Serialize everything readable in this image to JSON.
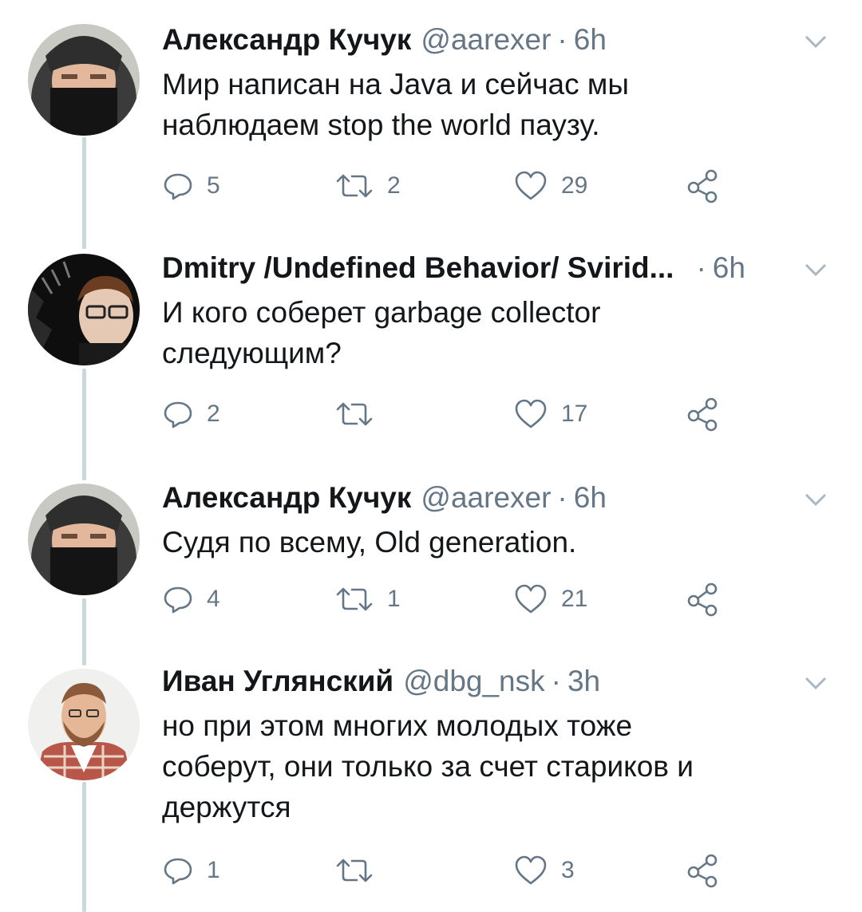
{
  "colors": {
    "text": "#14171a",
    "muted": "#657786",
    "line": "#ccd6dd"
  },
  "tweets": [
    {
      "name": "Александр Кучук",
      "handle": "@aarexer",
      "time": "6h",
      "text_lines": [
        "Мир написан на Java и сейчас мы",
        "наблюдаем stop the world паузу."
      ],
      "replies": "5",
      "retweets": "2",
      "likes": "29",
      "avatar_icon": "masked-person-avatar"
    },
    {
      "name": "Dmitry /Undefined Behavior/ Svirid...",
      "handle": "",
      "time": "6h",
      "text_lines": [
        "И кого соберет garbage collector",
        "следующим?"
      ],
      "replies": "2",
      "retweets": "",
      "likes": "17",
      "avatar_icon": "glasses-person-avatar"
    },
    {
      "name": "Александр Кучук",
      "handle": "@aarexer",
      "time": "6h",
      "text_lines": [
        "Судя по всему, Old generation."
      ],
      "replies": "4",
      "retweets": "1",
      "likes": "21",
      "avatar_icon": "masked-person-avatar"
    },
    {
      "name": "Иван Углянский",
      "handle": "@dbg_nsk",
      "time": "3h",
      "text_lines": [
        "но при этом многих молодых тоже",
        "соберут, они только за счет стариков и",
        "держутся"
      ],
      "replies": "1",
      "retweets": "",
      "likes": "3",
      "avatar_icon": "bearded-person-avatar"
    }
  ],
  "icons": [
    "reply-icon",
    "retweet-icon",
    "like-icon",
    "share-icon",
    "chevron-down-icon"
  ]
}
